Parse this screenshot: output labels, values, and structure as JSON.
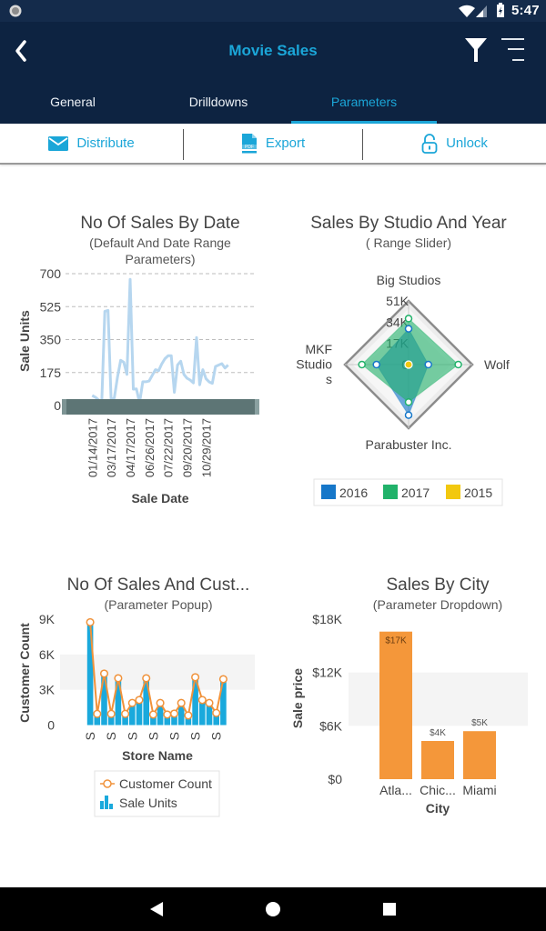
{
  "status_bar": {
    "time": "5:47",
    "icons": [
      "notification-dot-icon",
      "wifi-icon",
      "signal-icon",
      "battery-charging-icon"
    ]
  },
  "header": {
    "title": "Movie Sales",
    "back_icon": "chevron-left-icon",
    "filter_icon": "filter-icon",
    "menu_icon": "menu-icon"
  },
  "tabs": [
    {
      "label": "General",
      "active": false
    },
    {
      "label": "Drilldowns",
      "active": false
    },
    {
      "label": "Parameters",
      "active": true
    }
  ],
  "toolbar": [
    {
      "label": "Distribute",
      "icon": "envelope-icon"
    },
    {
      "label": "Export",
      "icon": "pdf-icon",
      "icon_text": "PDF"
    },
    {
      "label": "Unlock",
      "icon": "unlock-icon"
    }
  ],
  "colors": {
    "accent": "#1ba6d8",
    "status_bar_bg": "#142b4b",
    "header_bg": "#0d2341"
  },
  "nav_bar": {
    "icons": [
      "back-triangle-icon",
      "home-circle-icon",
      "recents-square-icon"
    ]
  },
  "chart_data": [
    {
      "type": "line",
      "title": "No Of Sales By Date",
      "subtitle": [
        "(Default And Date Range",
        "Parameters)"
      ],
      "xlabel": "Sale Date",
      "ylabel": "Sale Units",
      "ylim": [
        0,
        700
      ],
      "yticks": [
        {
          "value": 0,
          "label": "0"
        },
        {
          "value": 175,
          "label": "175"
        },
        {
          "value": 350,
          "label": "350"
        },
        {
          "value": 525,
          "label": "525"
        },
        {
          "value": 700,
          "label": "700"
        }
      ],
      "xlim": [
        -9,
        52
      ],
      "xticks": [
        {
          "index": 0,
          "label": "01/14/2017"
        },
        {
          "index": 6,
          "label": "03/17/2017"
        },
        {
          "index": 12,
          "label": "04/17/2017"
        },
        {
          "index": 18,
          "label": "06/26/2017"
        },
        {
          "index": 24,
          "label": "07/22/2017"
        },
        {
          "index": 30,
          "label": "09/20/2017"
        },
        {
          "index": 36,
          "label": "10/29/2017"
        }
      ],
      "series_name": "Sale Units",
      "color": "#b6d6ef",
      "values": [
        53,
        44,
        30,
        0,
        500,
        505,
        29,
        40,
        150,
        240,
        230,
        165,
        670,
        87,
        88,
        15,
        126,
        126,
        130,
        160,
        190,
        185,
        220,
        248,
        264,
        264,
        70,
        215,
        235,
        165,
        145,
        135,
        120,
        361,
        110,
        190,
        142,
        125,
        118,
        207,
        215,
        222,
        199,
        215
      ],
      "grid": true,
      "range_scrollbar": true
    },
    {
      "type": "radar",
      "title": "Sales By Studio And Year",
      "subtitle": "( Range Slider)",
      "axes": [
        {
          "name": "Big Studios",
          "lines": [
            "Big Studios"
          ]
        },
        {
          "name": "Wolf",
          "lines": [
            "Wolf"
          ]
        },
        {
          "name": "Parabuster Inc.",
          "lines": [
            "Parabuster Inc."
          ]
        },
        {
          "name": "MKF Studios",
          "lines": [
            "MKF",
            "Studio",
            "s"
          ]
        }
      ],
      "rlim": [
        0,
        51000
      ],
      "rticks": [
        {
          "value": 51000,
          "label": "51K"
        },
        {
          "value": 34000,
          "label": "34K"
        },
        {
          "value": 17000,
          "label": "17K"
        },
        {
          "value": 0,
          "label": "0"
        }
      ],
      "series": [
        {
          "name": "2016",
          "color": "#1677c9",
          "values": [
            28700,
            15800,
            40500,
            25700
          ]
        },
        {
          "name": "2017",
          "color": "#21b26a",
          "values": [
            36900,
            39800,
            30100,
            37400
          ]
        },
        {
          "name": "2015",
          "color": "#f2c80f",
          "values": [
            0,
            0,
            0,
            0
          ]
        }
      ],
      "legend": "bottom"
    },
    {
      "type": "bar",
      "title": "No Of Sales And Cust...",
      "subtitle": "(Parameter Popup)",
      "xlabel": "Store Name",
      "ylabel": "Customer Count",
      "ylim": [
        0,
        9000
      ],
      "yticks": [
        {
          "value": 0,
          "label": "0"
        },
        {
          "value": 3000,
          "label": "3K"
        },
        {
          "value": 6000,
          "label": "6K"
        },
        {
          "value": 9000,
          "label": "9K"
        }
      ],
      "xlim": [
        -4.3,
        23.5
      ],
      "xticks": [
        {
          "index": 0,
          "label": "S"
        },
        {
          "index": 3,
          "label": "S"
        },
        {
          "index": 6,
          "label": "S"
        },
        {
          "index": 9,
          "label": "S"
        },
        {
          "index": 12,
          "label": "S"
        },
        {
          "index": 15,
          "label": "S"
        },
        {
          "index": 18,
          "label": "S"
        }
      ],
      "band": [
        3000,
        6000
      ],
      "series": [
        {
          "name": "Customer Count",
          "type": "line",
          "color": "#f0923a",
          "values": [
            8740,
            950,
            4370,
            950,
            3980,
            950,
            1880,
            2130,
            3980,
            900,
            1880,
            900,
            970,
            1880,
            820,
            4060,
            2130,
            1880,
            1030,
            3900
          ]
        },
        {
          "name": "Sale Units",
          "type": "bar",
          "color": "#1aa9dc",
          "values": [
            8740,
            950,
            4370,
            950,
            3980,
            950,
            1880,
            2130,
            3980,
            900,
            1880,
            900,
            970,
            1880,
            820,
            4060,
            2130,
            1880,
            1030,
            3900
          ]
        }
      ],
      "legend": "bottom"
    },
    {
      "type": "bar",
      "title": "Sales By City",
      "subtitle": "(Parameter Dropdown)",
      "xlabel": "City",
      "ylabel": "Sale price",
      "ylim": [
        0,
        18000
      ],
      "yticks": [
        {
          "value": 0,
          "label": "$0"
        },
        {
          "value": 6000,
          "label": "$6K"
        },
        {
          "value": 12000,
          "label": "$12K"
        },
        {
          "value": 18000,
          "label": "$18K"
        }
      ],
      "band": [
        6000,
        12000
      ],
      "categories": [
        "Atla...",
        "Chic...",
        "Miami"
      ],
      "values": [
        16600,
        4300,
        5400
      ],
      "data_labels": [
        "$17K",
        "$4K",
        "$5K"
      ],
      "color": "#f4973a"
    }
  ]
}
